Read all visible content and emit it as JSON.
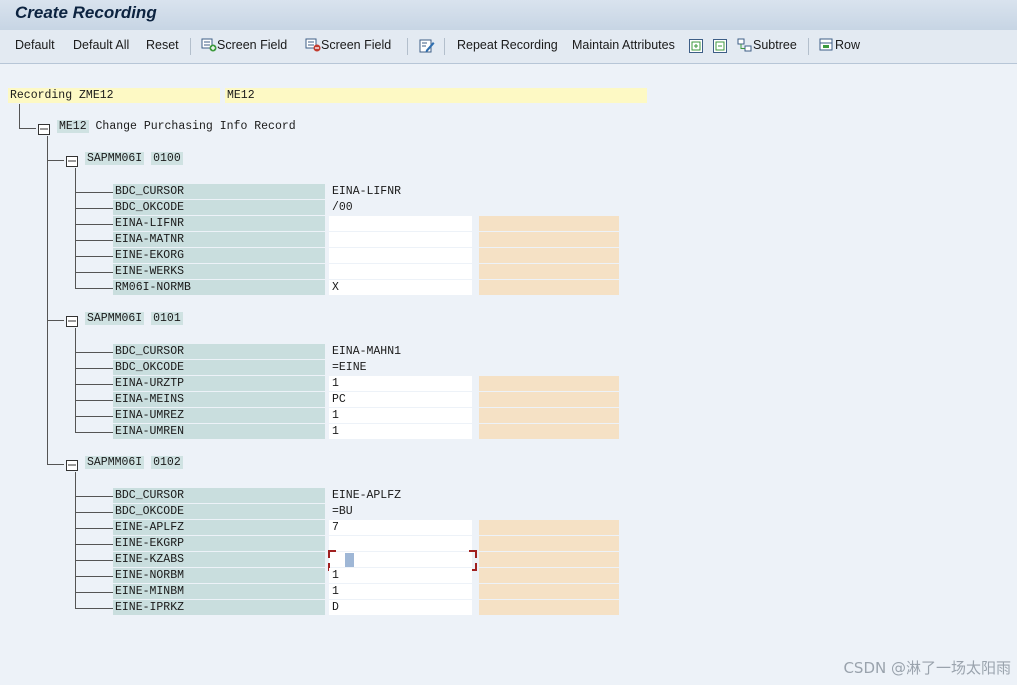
{
  "window": {
    "title": "Create Recording"
  },
  "toolbar": {
    "default": "Default",
    "default_all": "Default All",
    "reset": "Reset",
    "insert_screen_field": "Screen Field",
    "delete_screen_field": "Screen Field",
    "repeat_recording": "Repeat Recording",
    "maintain_attributes": "Maintain Attributes",
    "subtree": "Subtree",
    "row": "Row"
  },
  "recording": {
    "label": "Recording ZME12",
    "tcode": "ME12",
    "transaction": {
      "code": "ME12",
      "description": "Change Purchasing Info Record"
    }
  },
  "screens": [
    {
      "program": "SAPMM06I",
      "dynpro": "0100",
      "fields": [
        {
          "name": "BDC_CURSOR",
          "value": "EINA-LIFNR"
        },
        {
          "name": "BDC_OKCODE",
          "value": "/00"
        },
        {
          "name": "EINA-LIFNR",
          "value": ""
        },
        {
          "name": "EINA-MATNR",
          "value": ""
        },
        {
          "name": "EINE-EKORG",
          "value": ""
        },
        {
          "name": "EINE-WERKS",
          "value": ""
        },
        {
          "name": "RM06I-NORMB",
          "value": "X"
        }
      ]
    },
    {
      "program": "SAPMM06I",
      "dynpro": "0101",
      "fields": [
        {
          "name": "BDC_CURSOR",
          "value": "EINA-MAHN1"
        },
        {
          "name": "BDC_OKCODE",
          "value": "=EINE"
        },
        {
          "name": "EINA-URZTP",
          "value": "1"
        },
        {
          "name": "EINA-MEINS",
          "value": "PC"
        },
        {
          "name": "EINA-UMREZ",
          "value": "1"
        },
        {
          "name": "EINA-UMREN",
          "value": "1"
        }
      ]
    },
    {
      "program": "SAPMM06I",
      "dynpro": "0102",
      "fields": [
        {
          "name": "BDC_CURSOR",
          "value": "EINE-APLFZ"
        },
        {
          "name": "BDC_OKCODE",
          "value": "=BU"
        },
        {
          "name": "EINE-APLFZ",
          "value": "7"
        },
        {
          "name": "EINE-EKGRP",
          "value": ""
        },
        {
          "name": "EINE-KZABS",
          "value": ""
        },
        {
          "name": "EINE-NORBM",
          "value": "1"
        },
        {
          "name": "EINE-MINBM",
          "value": "1"
        },
        {
          "name": "EINE-IPRKZ",
          "value": "D"
        }
      ]
    }
  ],
  "watermark": "CSDN @淋了一场太阳雨",
  "colors": {
    "field_name_bg": "#c9dede",
    "value_bg": "#ffffff",
    "orange_cell": "#f5e1c5",
    "recording_bg": "#fdf9c4"
  }
}
